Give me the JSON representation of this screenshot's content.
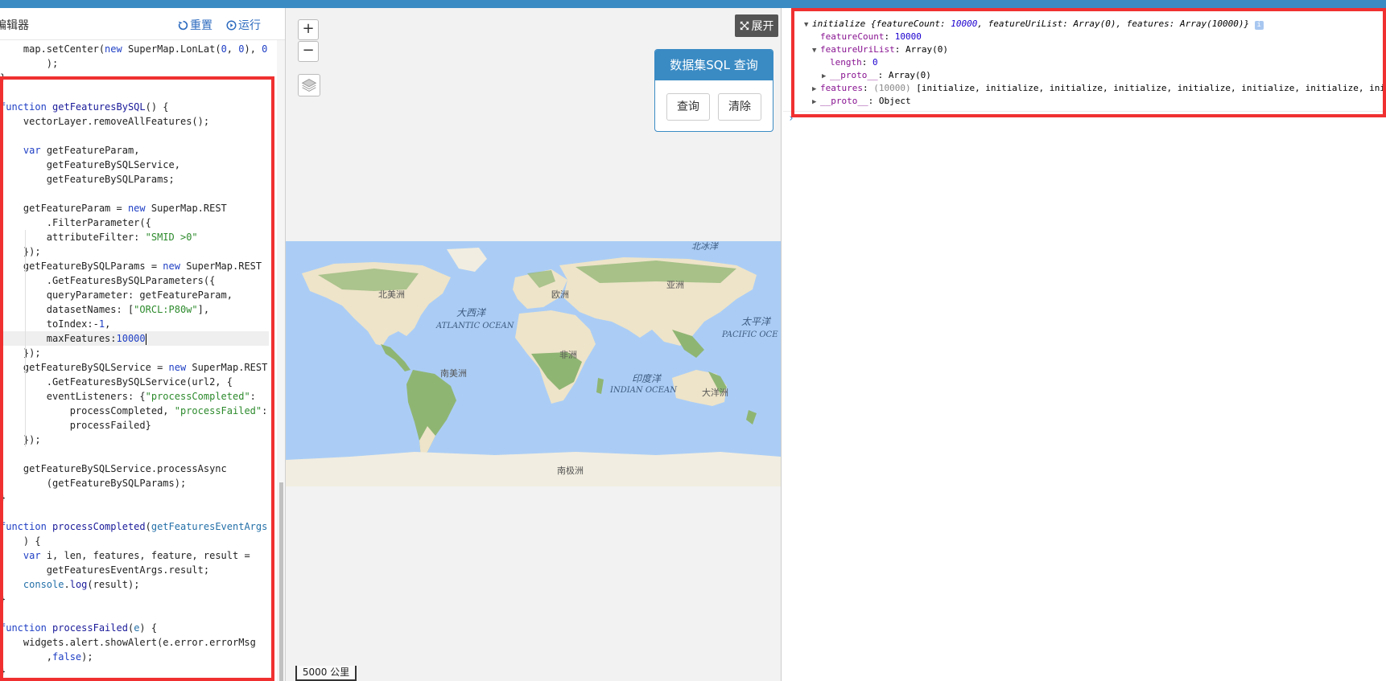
{
  "editor": {
    "title": "编辑器",
    "reset_label": "重置",
    "run_label": "运行",
    "code_lines": [
      {
        "segs": [
          [
            "",
            "    map.setCenter("
          ],
          [
            "kw",
            "new"
          ],
          [
            "",
            " SuperMap.LonLat("
          ],
          [
            "num",
            "0"
          ],
          [
            "",
            ", "
          ],
          [
            "num",
            "0"
          ],
          [
            "",
            "), "
          ],
          [
            "num",
            "0"
          ]
        ]
      },
      {
        "segs": [
          [
            "",
            "        );"
          ]
        ]
      },
      {
        "segs": [
          [
            "",
            "}"
          ]
        ]
      },
      {
        "segs": [
          [
            "",
            ""
          ]
        ]
      },
      {
        "segs": [
          [
            "kw",
            "function"
          ],
          [
            "",
            " "
          ],
          [
            "fn",
            "getFeaturesBySQL"
          ],
          [
            "",
            "() {"
          ]
        ]
      },
      {
        "segs": [
          [
            "",
            "    vectorLayer.removeAllFeatures();"
          ]
        ]
      },
      {
        "segs": [
          [
            "",
            ""
          ]
        ]
      },
      {
        "segs": [
          [
            "",
            "    "
          ],
          [
            "kw",
            "var"
          ],
          [
            "",
            " getFeatureParam,"
          ]
        ]
      },
      {
        "segs": [
          [
            "",
            "        getFeatureBySQLService,"
          ]
        ]
      },
      {
        "segs": [
          [
            "",
            "        getFeatureBySQLParams;"
          ]
        ]
      },
      {
        "segs": [
          [
            "",
            ""
          ]
        ]
      },
      {
        "segs": [
          [
            "",
            "    getFeatureParam = "
          ],
          [
            "kw",
            "new"
          ],
          [
            "",
            " SuperMap.REST"
          ]
        ]
      },
      {
        "segs": [
          [
            "",
            "        .FilterParameter({"
          ]
        ]
      },
      {
        "segs": [
          [
            "",
            "        attributeFilter: "
          ],
          [
            "str",
            "\"SMID >0\""
          ]
        ]
      },
      {
        "segs": [
          [
            "",
            "    });"
          ]
        ]
      },
      {
        "segs": [
          [
            "",
            "    getFeatureBySQLParams = "
          ],
          [
            "kw",
            "new"
          ],
          [
            "",
            " SuperMap.REST"
          ]
        ]
      },
      {
        "segs": [
          [
            "",
            "        .GetFeaturesBySQLParameters({"
          ]
        ]
      },
      {
        "segs": [
          [
            "",
            "        queryParameter: getFeatureParam,"
          ]
        ]
      },
      {
        "segs": [
          [
            "",
            "        datasetNames: ["
          ],
          [
            "str",
            "\"ORCL:P80w\""
          ],
          [
            "",
            "],"
          ]
        ]
      },
      {
        "segs": [
          [
            "",
            "        toIndex:-"
          ],
          [
            "num",
            "1"
          ],
          [
            "",
            ","
          ]
        ]
      },
      {
        "segs": [
          [
            "",
            "        maxFeatures:"
          ],
          [
            "num",
            "10000"
          ]
        ],
        "active": true
      },
      {
        "segs": [
          [
            "",
            "    });"
          ]
        ]
      },
      {
        "segs": [
          [
            "",
            "    getFeatureBySQLService = "
          ],
          [
            "kw",
            "new"
          ],
          [
            "",
            " SuperMap.REST"
          ]
        ]
      },
      {
        "segs": [
          [
            "",
            "        .GetFeaturesBySQLService(url2, {"
          ]
        ]
      },
      {
        "segs": [
          [
            "",
            "        eventListeners: {"
          ],
          [
            "str",
            "\"processCompleted\""
          ],
          [
            "",
            ":"
          ]
        ]
      },
      {
        "segs": [
          [
            "",
            "            processCompleted, "
          ],
          [
            "str",
            "\"processFailed\""
          ],
          [
            "",
            ":"
          ]
        ]
      },
      {
        "segs": [
          [
            "",
            "            processFailed}"
          ]
        ]
      },
      {
        "segs": [
          [
            "",
            "    });"
          ]
        ]
      },
      {
        "segs": [
          [
            "",
            ""
          ]
        ]
      },
      {
        "segs": [
          [
            "",
            "    getFeatureBySQLService.processAsync"
          ]
        ]
      },
      {
        "segs": [
          [
            "",
            "        (getFeatureBySQLParams);"
          ]
        ]
      },
      {
        "segs": [
          [
            "",
            "}"
          ]
        ]
      },
      {
        "segs": [
          [
            "",
            ""
          ]
        ]
      },
      {
        "segs": [
          [
            "kw",
            "function"
          ],
          [
            "",
            " "
          ],
          [
            "fn",
            "processCompleted"
          ],
          [
            "",
            "("
          ],
          [
            "var",
            "getFeaturesEventArgs"
          ]
        ]
      },
      {
        "segs": [
          [
            "",
            "    ) {"
          ]
        ]
      },
      {
        "segs": [
          [
            "",
            "    "
          ],
          [
            "kw",
            "var"
          ],
          [
            "",
            " i, len, features, feature, result ="
          ]
        ]
      },
      {
        "segs": [
          [
            "",
            "        getFeaturesEventArgs.result;"
          ]
        ]
      },
      {
        "segs": [
          [
            "",
            "    "
          ],
          [
            "var",
            "console"
          ],
          [
            "",
            "."
          ],
          [
            "fn",
            "log"
          ],
          [
            "",
            "(result);"
          ]
        ]
      },
      {
        "segs": [
          [
            "",
            "}"
          ]
        ]
      },
      {
        "segs": [
          [
            "",
            ""
          ]
        ]
      },
      {
        "segs": [
          [
            "kw",
            "function"
          ],
          [
            "",
            " "
          ],
          [
            "fn",
            "processFailed"
          ],
          [
            "",
            "("
          ],
          [
            "var",
            "e"
          ],
          [
            "",
            ") {"
          ]
        ]
      },
      {
        "segs": [
          [
            "",
            "    widgets.alert.showAlert(e.error.errorMsg"
          ]
        ]
      },
      {
        "segs": [
          [
            "",
            "        ,"
          ],
          [
            "kw",
            "false"
          ],
          [
            "",
            ");"
          ]
        ]
      },
      {
        "segs": [
          [
            "",
            "}"
          ]
        ]
      }
    ]
  },
  "map": {
    "zoom_in": "+",
    "zoom_out": "−",
    "expand_label": "展开",
    "panel_title": "数据集SQL 查询",
    "query_label": "查询",
    "clear_label": "清除",
    "scale_label": "5000 公里",
    "labels": {
      "arctic": "北冰洋",
      "north_america": "北美洲",
      "europe": "欧洲",
      "asia": "亚洲",
      "atlantic_cn": "大西洋",
      "atlantic_en": "ATLANTIC OCEAN",
      "pacific_cn": "太平洋",
      "pacific_en": "PACIFIC OCE",
      "africa": "非洲",
      "south_america": "南美洲",
      "indian_cn": "印度洋",
      "indian_en": "INDIAN OCEAN",
      "oceania": "大洋洲",
      "antarctica": "南极洲"
    },
    "colors": {
      "ocean": "#abcdf5",
      "land": "#eee4c9",
      "forest": "#8fb573",
      "ice": "#f1ede0"
    }
  },
  "console": {
    "line1": {
      "name": "initialize",
      "preview_open": "{featureCount: ",
      "count": "10000",
      "mid": ", featureUriList: Array(0), features: Array(10000)}",
      "info": "i"
    },
    "line2": {
      "key": "featureCount",
      "value": "10000"
    },
    "line3": {
      "key": "featureUriList",
      "value": "Array(0)"
    },
    "line4": {
      "key": "length",
      "value": "0"
    },
    "line5": {
      "key": "__proto__",
      "value": "Array(0)"
    },
    "line6": {
      "key": "features",
      "count": "(10000)",
      "value": "[initialize, initialize, initialize, initialize, initialize, initialize, initialize, ini"
    },
    "line7": {
      "key": "__proto__",
      "value": "Object"
    },
    "prompt": "›"
  }
}
